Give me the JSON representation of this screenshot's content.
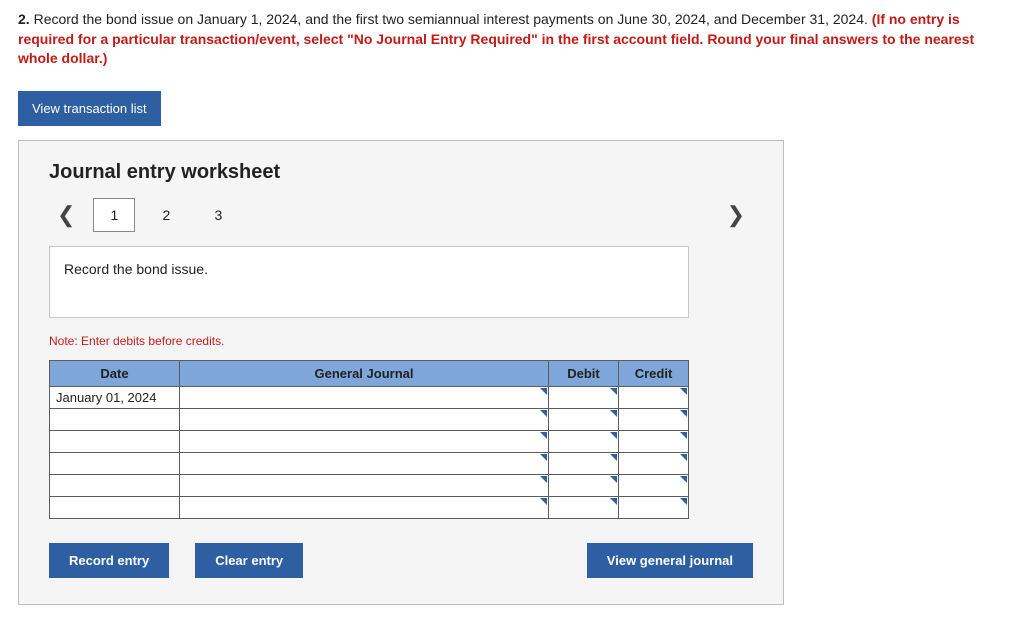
{
  "question": {
    "number": "2.",
    "plain": "Record the bond issue on January 1, 2024, and the first two semiannual interest payments on June 30, 2024, and December 31, 2024. ",
    "highlight": "(If no entry is required for a particular transaction/event, select \"No Journal Entry Required\" in the first account field. Round your final answers to the nearest whole dollar.)"
  },
  "buttons": {
    "view_transaction_list": "View transaction list",
    "record_entry": "Record entry",
    "clear_entry": "Clear entry",
    "view_general_journal": "View general journal"
  },
  "worksheet": {
    "title": "Journal entry worksheet",
    "tabs": [
      "1",
      "2",
      "3"
    ],
    "active_tab_index": 0,
    "instruction": "Record the bond issue.",
    "note": "Note: Enter debits before credits.",
    "headers": {
      "date": "Date",
      "general_journal": "General Journal",
      "debit": "Debit",
      "credit": "Credit"
    },
    "rows": [
      {
        "date": "January 01, 2024",
        "gj": "",
        "debit": "",
        "credit": ""
      },
      {
        "date": "",
        "gj": "",
        "debit": "",
        "credit": ""
      },
      {
        "date": "",
        "gj": "",
        "debit": "",
        "credit": ""
      },
      {
        "date": "",
        "gj": "",
        "debit": "",
        "credit": ""
      },
      {
        "date": "",
        "gj": "",
        "debit": "",
        "credit": ""
      },
      {
        "date": "",
        "gj": "",
        "debit": "",
        "credit": ""
      }
    ]
  }
}
